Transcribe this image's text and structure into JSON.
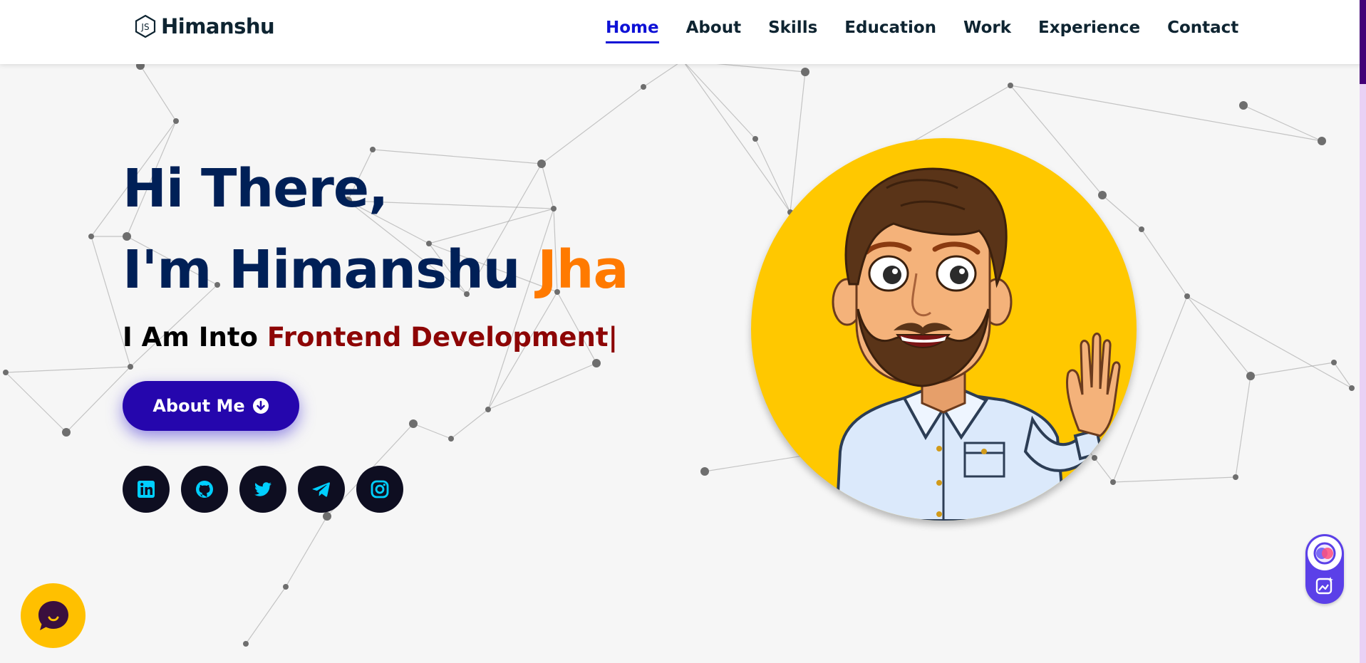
{
  "brand": {
    "name": "Himanshu",
    "logo_icon": "nodejs-hexagon-icon"
  },
  "nav": {
    "items": [
      {
        "label": "Home",
        "active": true
      },
      {
        "label": "About",
        "active": false
      },
      {
        "label": "Skills",
        "active": false
      },
      {
        "label": "Education",
        "active": false
      },
      {
        "label": "Work",
        "active": false
      },
      {
        "label": "Experience",
        "active": false
      },
      {
        "label": "Contact",
        "active": false
      }
    ],
    "active_color": "#0e11d6"
  },
  "hero": {
    "line1": "Hi There,",
    "line2_prefix": "I'm Himanshu ",
    "line2_accent": "Jha",
    "typed_prefix": "I Am Into ",
    "typed_role": "Frontend Development",
    "caret": "|",
    "heading_color": "#002057",
    "accent_color": "#ff7a00",
    "role_color": "#8d0505"
  },
  "about_button": {
    "label": "About Me",
    "icon": "arrow-circle-down-icon",
    "color": "#2506ad"
  },
  "socials": [
    {
      "name": "linkedin",
      "icon": "linkedin-icon"
    },
    {
      "name": "github",
      "icon": "github-icon"
    },
    {
      "name": "twitter",
      "icon": "twitter-icon"
    },
    {
      "name": "telegram",
      "icon": "telegram-icon"
    },
    {
      "name": "instagram",
      "icon": "instagram-icon"
    }
  ],
  "avatar": {
    "description_icon": "bitmoji-avatar-waving",
    "bg_color": "#ffc800"
  },
  "widgets": {
    "chat": {
      "icon": "chat-bubble-icon",
      "color": "#ffc000"
    },
    "floating": {
      "icons": [
        "assistant-orb-icon",
        "image-sparkle-icon"
      ],
      "color": "#5b40e8"
    }
  }
}
